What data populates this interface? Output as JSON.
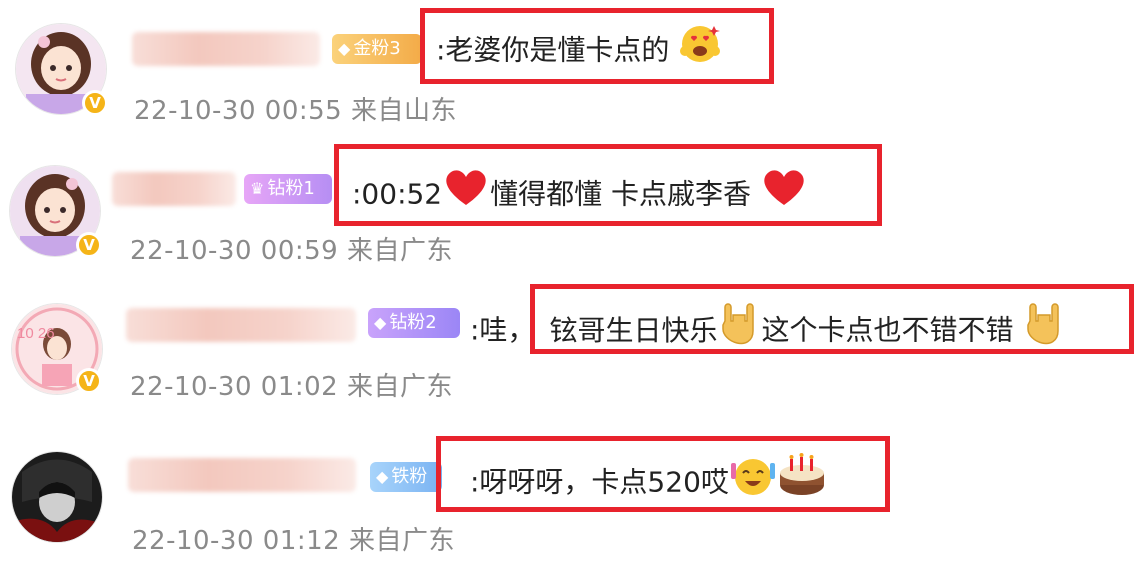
{
  "comments": [
    {
      "badge": "金粉3",
      "badge_icon": "gem-icon",
      "text": ":老婆你是懂卡点的",
      "emoji": "heart-eyes-face-icon",
      "time": "22-10-30 00:55",
      "location": "来自山东"
    },
    {
      "badge": "钻粉1",
      "badge_icon": "crown-icon",
      "text_prefix": ":00:52",
      "text_mid": "懂得都懂 卡点戚李香",
      "emoji": "red-heart-icon",
      "time": "22-10-30 00:59",
      "location": "来自广东"
    },
    {
      "badge": "钻粉2",
      "badge_icon": "diamond-icon",
      "text_prefix": ":哇，",
      "text_a": "铉哥生日快乐",
      "text_b": "这个卡点也不错不错",
      "emoji": "rock-on-hand-icon",
      "time": "22-10-30 01:02",
      "location": "来自广东"
    },
    {
      "badge": "铁粉",
      "badge_icon": "diamond-icon",
      "text": ":呀呀呀，卡点520哎",
      "emoji_a": "party-face-icon",
      "emoji_b": "birthday-cake-icon",
      "time": "22-10-30 01:12",
      "location": "来自广东"
    }
  ],
  "verified_mark": "V",
  "avatar_label": "10 26",
  "colors": {
    "highlight": "#e8232d",
    "meta_text": "#8a8a8a",
    "verified": "#f5b418"
  }
}
